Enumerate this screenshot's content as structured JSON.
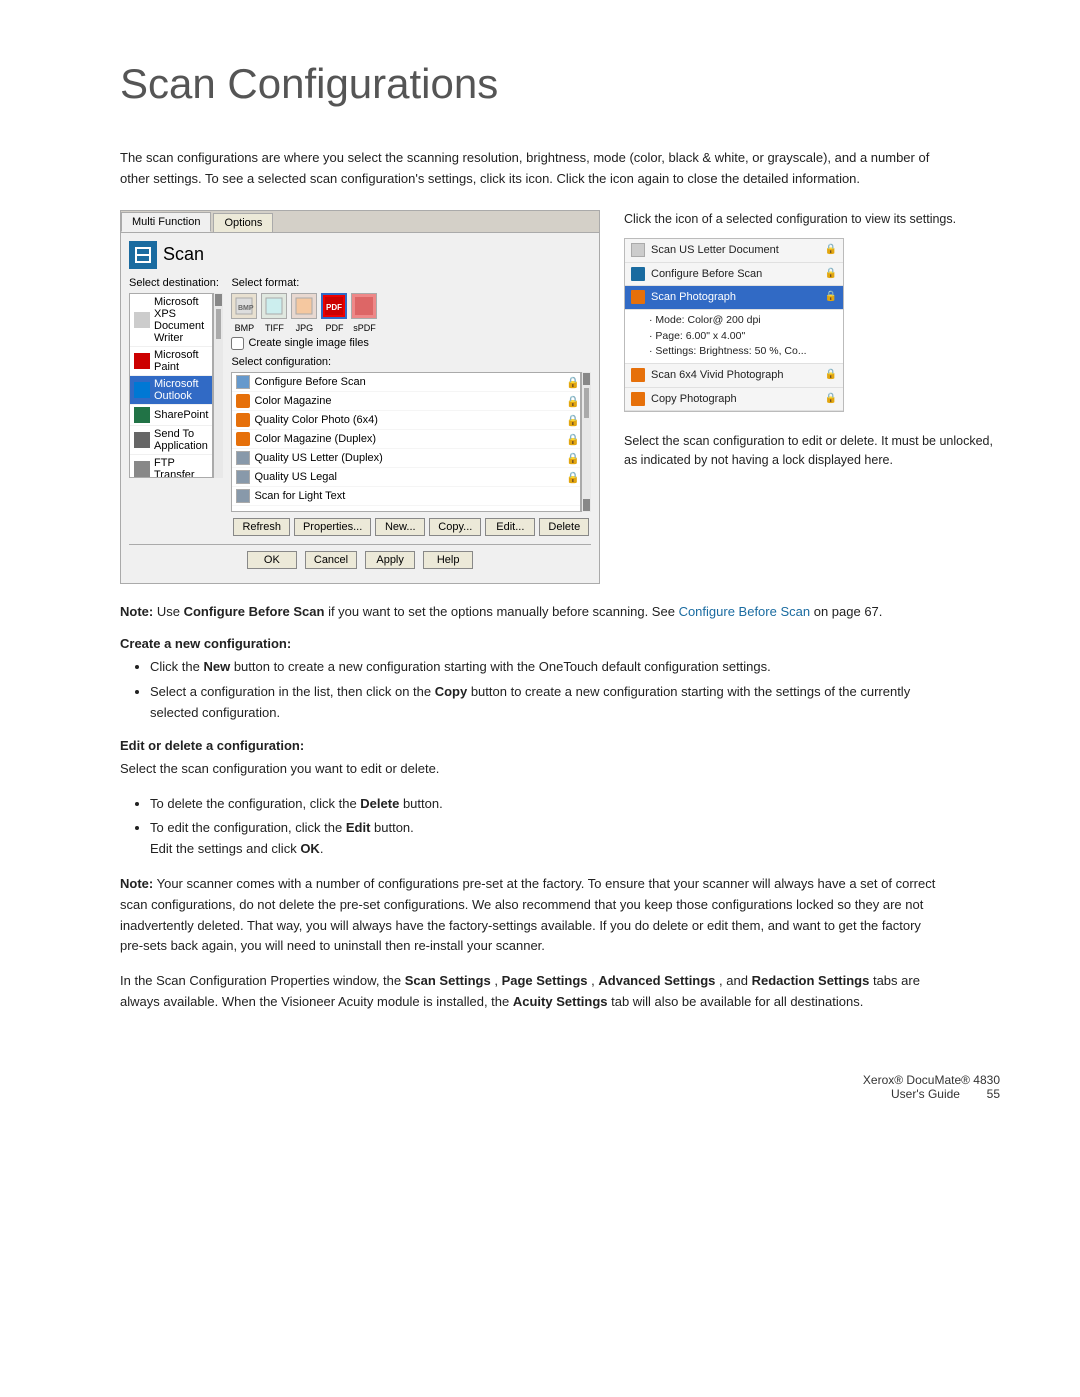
{
  "page": {
    "title": "Scan Configurations",
    "intro": "The scan configurations are where you select the scanning resolution, brightness, mode (color, black & white, or grayscale), and a number of other settings. To see a selected scan configuration's settings, click its icon. Click the icon again to close the detailed information.",
    "annotation1": "Click the icon of a selected configuration to view its settings.",
    "annotation2": "Select the scan configuration to edit or delete. It must be unlocked, as indicated by not having a lock displayed here.",
    "note1_prefix": "Note: ",
    "note1_bold": "Use Configure Before Scan",
    "note1_text": " if you want to set the options manually before scanning. See ",
    "note1_link": "Configure Before Scan",
    "note1_suffix": " on page 67.",
    "section1_heading": "Create a new configuration:",
    "bullet1a_prefix": "Click the ",
    "bullet1a_bold": "New",
    "bullet1a_text": " button to create a new configuration starting with the OneTouch default configuration settings.",
    "bullet1b_prefix": "Select a configuration in the list, then click on the ",
    "bullet1b_bold": "Copy",
    "bullet1b_text": " button to create a new configuration starting with the settings of the currently selected configuration.",
    "section2_heading": "Edit or delete a configuration:",
    "edit_intro": "Select the scan configuration you want to edit or delete.",
    "bullet2a_prefix": "To delete the configuration, click the ",
    "bullet2a_bold": "Delete",
    "bullet2a_text": " button.",
    "bullet2b_prefix": "To edit the configuration, click the ",
    "bullet2b_bold": "Edit",
    "bullet2b_text": " button.",
    "bullet2b_sub": "Edit the settings and click ",
    "bullet2b_sub_bold": "OK",
    "bullet2b_sub_end": ".",
    "note2_prefix": "Note: ",
    "note2_text": "Your scanner comes with a number of configurations pre-set at the factory. To ensure that your scanner will always have a set of correct scan configurations, do not delete the pre-set configurations. We also recommend that you keep those configurations locked so they are not inadvertently deleted. That way, you will always have the factory-settings available. If you do delete or edit them, and want to get the factory pre-sets back again, you will need to uninstall then re-install your scanner.",
    "note3_text": "In the Scan Configuration Properties window, the ",
    "note3_bold1": "Scan Settings",
    "note3_mid1": ", ",
    "note3_bold2": "Page Settings",
    "note3_mid2": ", ",
    "note3_bold3": "Advanced Settings",
    "note3_mid3": ", and ",
    "note3_bold4": "Redaction Settings",
    "note3_mid4": " tabs are always available. When the Visioneer Acuity module is installed, the ",
    "note3_bold5": "Acuity Settings",
    "note3_end": " tab will also be available for all destinations.",
    "footer_product": "Xerox® DocuMate® 4830",
    "footer_guide": "User's Guide",
    "footer_page": "55"
  },
  "dialog": {
    "tabs": [
      "Multi Function",
      "Options"
    ],
    "active_tab": "Multi Function",
    "scan_label": "Scan",
    "select_dest_label": "Select destination:",
    "destinations": [
      {
        "label": "Microsoft XPS Document Writer",
        "icon": "doc"
      },
      {
        "label": "Microsoft Paint",
        "icon": "red"
      },
      {
        "label": "Microsoft Outlook",
        "icon": "outlook",
        "selected": true
      },
      {
        "label": "SharePoint",
        "icon": "share"
      },
      {
        "label": "Send To Application",
        "icon": "send"
      },
      {
        "label": "FTP Transfer",
        "icon": "ftp"
      }
    ],
    "select_format_label": "Select format:",
    "formats": [
      "BMP",
      "TIFF",
      "JPG",
      "PDF",
      "sPDF"
    ],
    "active_format": "PDF",
    "create_single_label": "Create single image files",
    "select_config_label": "Select configuration:",
    "configurations": [
      {
        "label": "Configure Before Scan",
        "icon": "doc",
        "locked": true
      },
      {
        "label": "Color Magazine",
        "icon": "color",
        "locked": true
      },
      {
        "label": "Quality Color Photo (6x4)",
        "icon": "color",
        "locked": true
      },
      {
        "label": "Color Magazine (Duplex)",
        "icon": "color",
        "locked": true
      },
      {
        "label": "Quality US Letter (Duplex)",
        "icon": "doc",
        "locked": true
      },
      {
        "label": "Quality US Legal",
        "icon": "doc",
        "locked": true
      },
      {
        "label": "Scan for Light Text",
        "icon": "doc",
        "locked": false
      }
    ],
    "bottom_buttons": [
      "Refresh",
      "Properties...",
      "New...",
      "Copy...",
      "Edit...",
      "Delete"
    ],
    "footer_buttons": [
      "OK",
      "Cancel",
      "Apply",
      "Help"
    ]
  },
  "mini_list": {
    "items": [
      {
        "label": "Scan US Letter Document",
        "icon": "doc",
        "locked": true,
        "selected": false
      },
      {
        "label": "Configure Before Scan",
        "icon": "doc",
        "locked": true,
        "selected": false
      },
      {
        "label": "Scan Photograph",
        "icon": "orange",
        "locked": true,
        "selected": true,
        "detail": "· Mode: Color@ 200 dpi\n· Page: 6.00\" x 4.00\"\n· Settings: Brightness: 50 %, Co..."
      },
      {
        "label": "Scan 6x4 Vivid Photograph",
        "icon": "orange",
        "locked": true,
        "selected": false
      },
      {
        "label": "Copy Photograph",
        "icon": "orange",
        "locked": true,
        "selected": false
      }
    ]
  }
}
